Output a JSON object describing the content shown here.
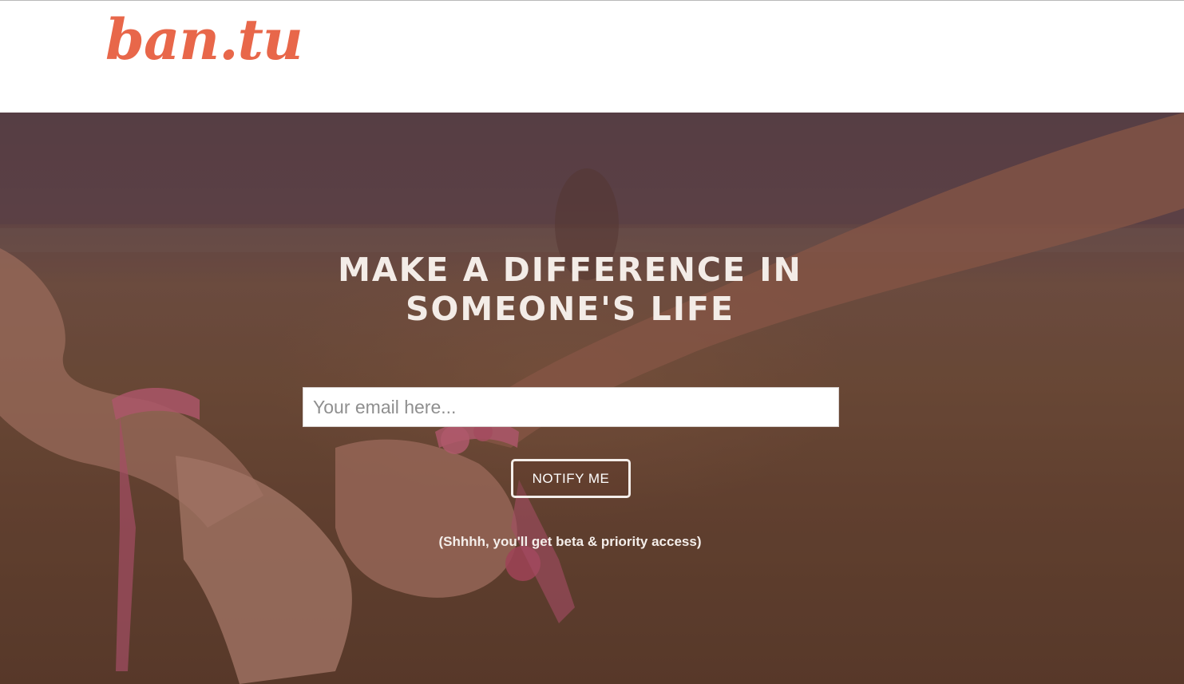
{
  "brand": {
    "logo_text": "ban.tu",
    "accent_color": "#e8674a"
  },
  "hero": {
    "image_icon": "hands-holding-photo",
    "headline_line1": "MAKE A DIFFERENCE IN",
    "headline_line2": "SOMEONE'S LIFE",
    "email_placeholder": "Your email here...",
    "email_value": "",
    "notify_label": "NOTIFY ME",
    "note": "(Shhhh, you'll get beta & priority access)"
  }
}
